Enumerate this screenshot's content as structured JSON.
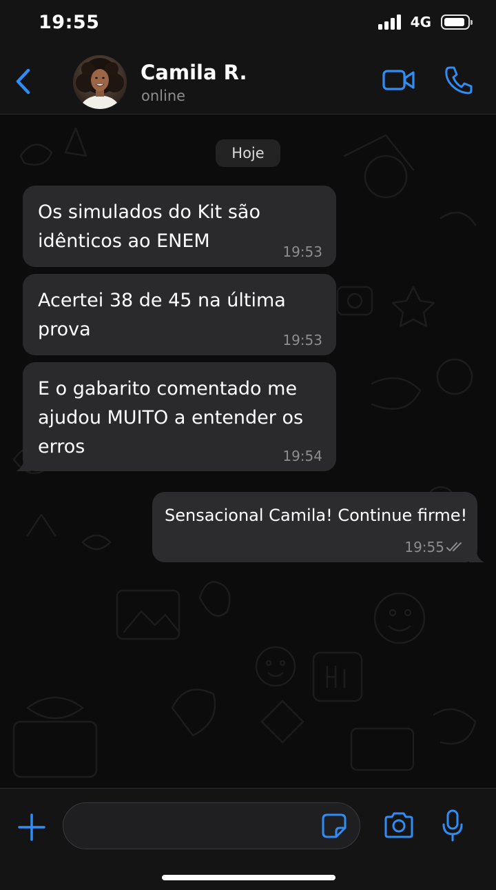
{
  "status_bar": {
    "time": "19:55",
    "network": "4G"
  },
  "header": {
    "contact_name": "Camila R.",
    "contact_status": "online",
    "icons": [
      "back-icon",
      "video-call-icon",
      "phone-icon"
    ]
  },
  "chat": {
    "date_label": "Hoje",
    "messages": [
      {
        "direction": "incoming",
        "text": "Os simulados do Kit são\nidênticos ao ENEM",
        "time": "19:53"
      },
      {
        "direction": "incoming",
        "text": "Acertei 38 de 45 na última\nprova",
        "time": "19:53"
      },
      {
        "direction": "incoming",
        "text": "E o gabarito comentado me\najudou MUITO a entender os\nerros",
        "time": "19:54"
      },
      {
        "direction": "outgoing",
        "text": "Sensacional Camila! Continue firme!",
        "time": "19:55",
        "status": "read"
      }
    ]
  },
  "input_bar": {
    "placeholder": "",
    "icons": [
      "plus-icon",
      "sticker-icon",
      "camera-icon",
      "mic-icon"
    ]
  },
  "colors": {
    "accent": "#2f8ef5",
    "background": "#0b0b0b",
    "bar_background": "#141414",
    "bubble": "#2a2a2c",
    "secondary_text": "#8e8e8e"
  }
}
